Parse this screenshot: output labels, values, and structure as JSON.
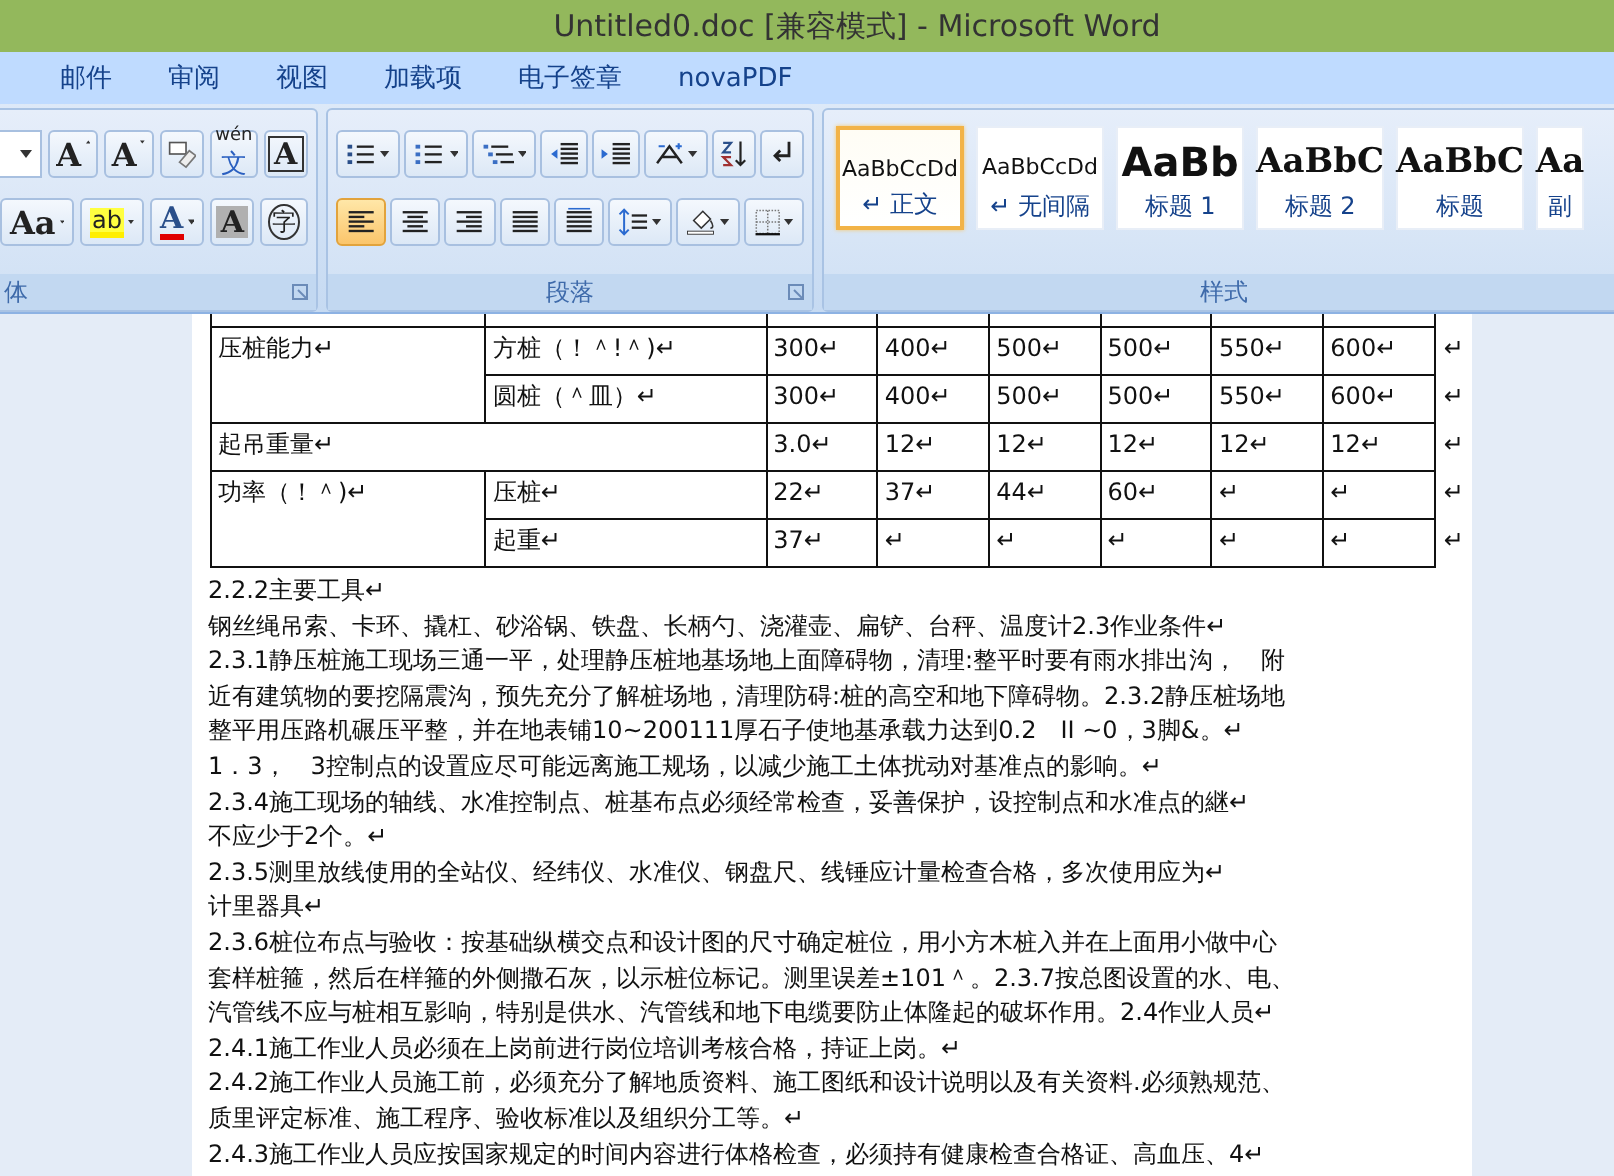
{
  "window": {
    "title": "Untitled0.doc [兼容模式] - Microsoft Word"
  },
  "tabs": [
    {
      "label": "邮件",
      "selected": false
    },
    {
      "label": "审阅",
      "selected": false
    },
    {
      "label": "视图",
      "selected": false
    },
    {
      "label": "加载项",
      "selected": false
    },
    {
      "label": "电子签章",
      "selected": false
    },
    {
      "label": "novaPDF",
      "selected": false
    }
  ],
  "font_group": {
    "label": "体",
    "row1": [
      {
        "kind": "size"
      },
      {
        "kind": "grow",
        "glyph": "A"
      },
      {
        "kind": "shrink",
        "glyph": "A"
      },
      {
        "kind": "clear"
      },
      {
        "kind": "phonetic",
        "glyph": "文",
        "ruby": "wén"
      },
      {
        "kind": "border",
        "glyph": "A"
      }
    ],
    "row2": [
      {
        "kind": "case",
        "glyph": "Aa"
      },
      {
        "kind": "highlight",
        "glyph": "ab"
      },
      {
        "kind": "color",
        "glyph": "A"
      },
      {
        "kind": "shade",
        "glyph": "A"
      },
      {
        "kind": "enclose",
        "glyph": "字"
      }
    ]
  },
  "paragraph_group": {
    "label": "段落",
    "row1": [
      {
        "kind": "bullets",
        "selected": false
      },
      {
        "kind": "numbering",
        "selected": false
      },
      {
        "kind": "multilevel",
        "selected": false
      },
      {
        "kind": "outdent",
        "selected": false
      },
      {
        "kind": "indent",
        "selected": false
      },
      {
        "kind": "layout",
        "selected": false
      },
      {
        "kind": "sort",
        "selected": false
      },
      {
        "kind": "marks",
        "selected": false
      }
    ],
    "row2": [
      {
        "kind": "left",
        "selected": true
      },
      {
        "kind": "center",
        "selected": false
      },
      {
        "kind": "right",
        "selected": false
      },
      {
        "kind": "justify",
        "selected": false
      },
      {
        "kind": "distribute",
        "selected": false
      },
      {
        "kind": "spacing",
        "selected": false
      },
      {
        "kind": "shading",
        "selected": false
      },
      {
        "kind": "borders",
        "selected": false
      }
    ]
  },
  "styles_group": {
    "label": "样式",
    "items": [
      {
        "kind": "normal",
        "preview": "AaBbCcDd",
        "label": "↵ 正文",
        "selected": true
      },
      {
        "kind": "normal",
        "preview": "AaBbCcDd",
        "label": "↵ 无间隔",
        "selected": false
      },
      {
        "kind": "heading1",
        "preview": "AaBb",
        "label": "标题 1",
        "selected": false
      },
      {
        "kind": "heading2",
        "preview": "AaBbC",
        "label": "标题 2",
        "selected": false
      },
      {
        "kind": "heading2",
        "preview": "AaBbC",
        "label": "标题",
        "selected": false
      },
      {
        "kind": "heading2",
        "preview": "Aa",
        "label": "副",
        "selected": false
      }
    ]
  },
  "table": {
    "rows": [
      {
        "cells": [
          {
            "text": "压桩能力↵",
            "rowspan": 2
          },
          {
            "text": "方桩（！＾!＾)↵"
          },
          {
            "text": "300↵"
          },
          {
            "text": "400↵"
          },
          {
            "text": "500↵"
          },
          {
            "text": "500↵"
          },
          {
            "text": "550↵"
          },
          {
            "text": "600↵"
          }
        ],
        "end": "↵"
      },
      {
        "cells": [
          {
            "text": "圆桩（＾皿）↵"
          },
          {
            "text": "300↵"
          },
          {
            "text": "400↵"
          },
          {
            "text": "500↵"
          },
          {
            "text": "500↵"
          },
          {
            "text": "550↵"
          },
          {
            "text": "600↵"
          }
        ],
        "end": "↵"
      },
      {
        "cells": [
          {
            "text": "起吊重量↵",
            "colspan": 2
          },
          {
            "text": "3.0↵"
          },
          {
            "text": "12↵"
          },
          {
            "text": "12↵"
          },
          {
            "text": "12↵"
          },
          {
            "text": "12↵"
          },
          {
            "text": "12↵"
          }
        ],
        "end": "↵"
      },
      {
        "cells": [
          {
            "text": "功率（！＾)↵",
            "rowspan": 2
          },
          {
            "text": "压桩↵"
          },
          {
            "text": "22↵"
          },
          {
            "text": "37↵"
          },
          {
            "text": "44↵"
          },
          {
            "text": "60↵"
          },
          {
            "text": "↵"
          },
          {
            "text": "↵"
          }
        ],
        "end": "↵"
      },
      {
        "cells": [
          {
            "text": "起重↵"
          },
          {
            "text": "37↵"
          },
          {
            "text": "↵"
          },
          {
            "text": "↵"
          },
          {
            "text": "↵"
          },
          {
            "text": "↵"
          },
          {
            "text": "↵"
          }
        ],
        "end": "↵"
      }
    ]
  },
  "lines": [
    "2.2.2主要工具↵",
    "钢丝绳吊索、卡环、撬杠、砂浴锅、铁盘、长柄勺、浇灌壶、扁铲、台秤、温度计2.3作业条件↵",
    "2.3.1静压桩施工现场三通一平，处理静压桩地基场地上面障碍物，清理:整平时要有雨水排出沟，　附",
    "近有建筑物的要挖隔震沟，预先充分了解桩场地，清理防碍:桩的高空和地下障碍物。2.3.2静压桩场地",
    "整平用压路机碾压平整，并在地表铺10~200111厚石子使地基承载力达到0.2　II ~0，3脚&。↵",
    "1．3，　3控制点的设置应尽可能远离施工规场，以减少施工土体扰动对基准点的影响。↵",
    "2.3.4施工现场的轴线、水准控制点、桩基布点必须经常检查，妥善保护，设控制点和水准点的継↵",
    "不应少于2个。↵",
    "2.3.5测里放线使用的全站仪、经纬仪、水准仪、钢盘尺、线锤应计量检查合格，多次使用应为↵",
    "计里器具↵",
    "2.3.6桩位布点与验收：按基础纵横交点和设计图的尺寸确定桩位，用小方木桩入并在上面用小做中心",
    "套样桩箍，然后在样箍的外侧撒石灰，以示桩位标记。测里误差±101＾。2.3.7按总图设置的水、电、",
    "汽管线不应与桩相互影响，特别是供水、汽管线和地下电缆要防止体隆起的破坏作用。2.4作业人员↵",
    "2.4.1施工作业人员必须在上岗前进行岗位培训考核合格，持证上岗。↵",
    "2.4.2施工作业人员施工前，必须充分了解地质资料、施工图纸和设计说明以及有关资料.必须熟规范、",
    "质里评定标准、施工程序、验收标准以及组织分工等。↵",
    "2.4.3施工作业人员应按国家规定的时间内容进行体格检查，必须持有健康检查合格证、高血压、4↵"
  ]
}
